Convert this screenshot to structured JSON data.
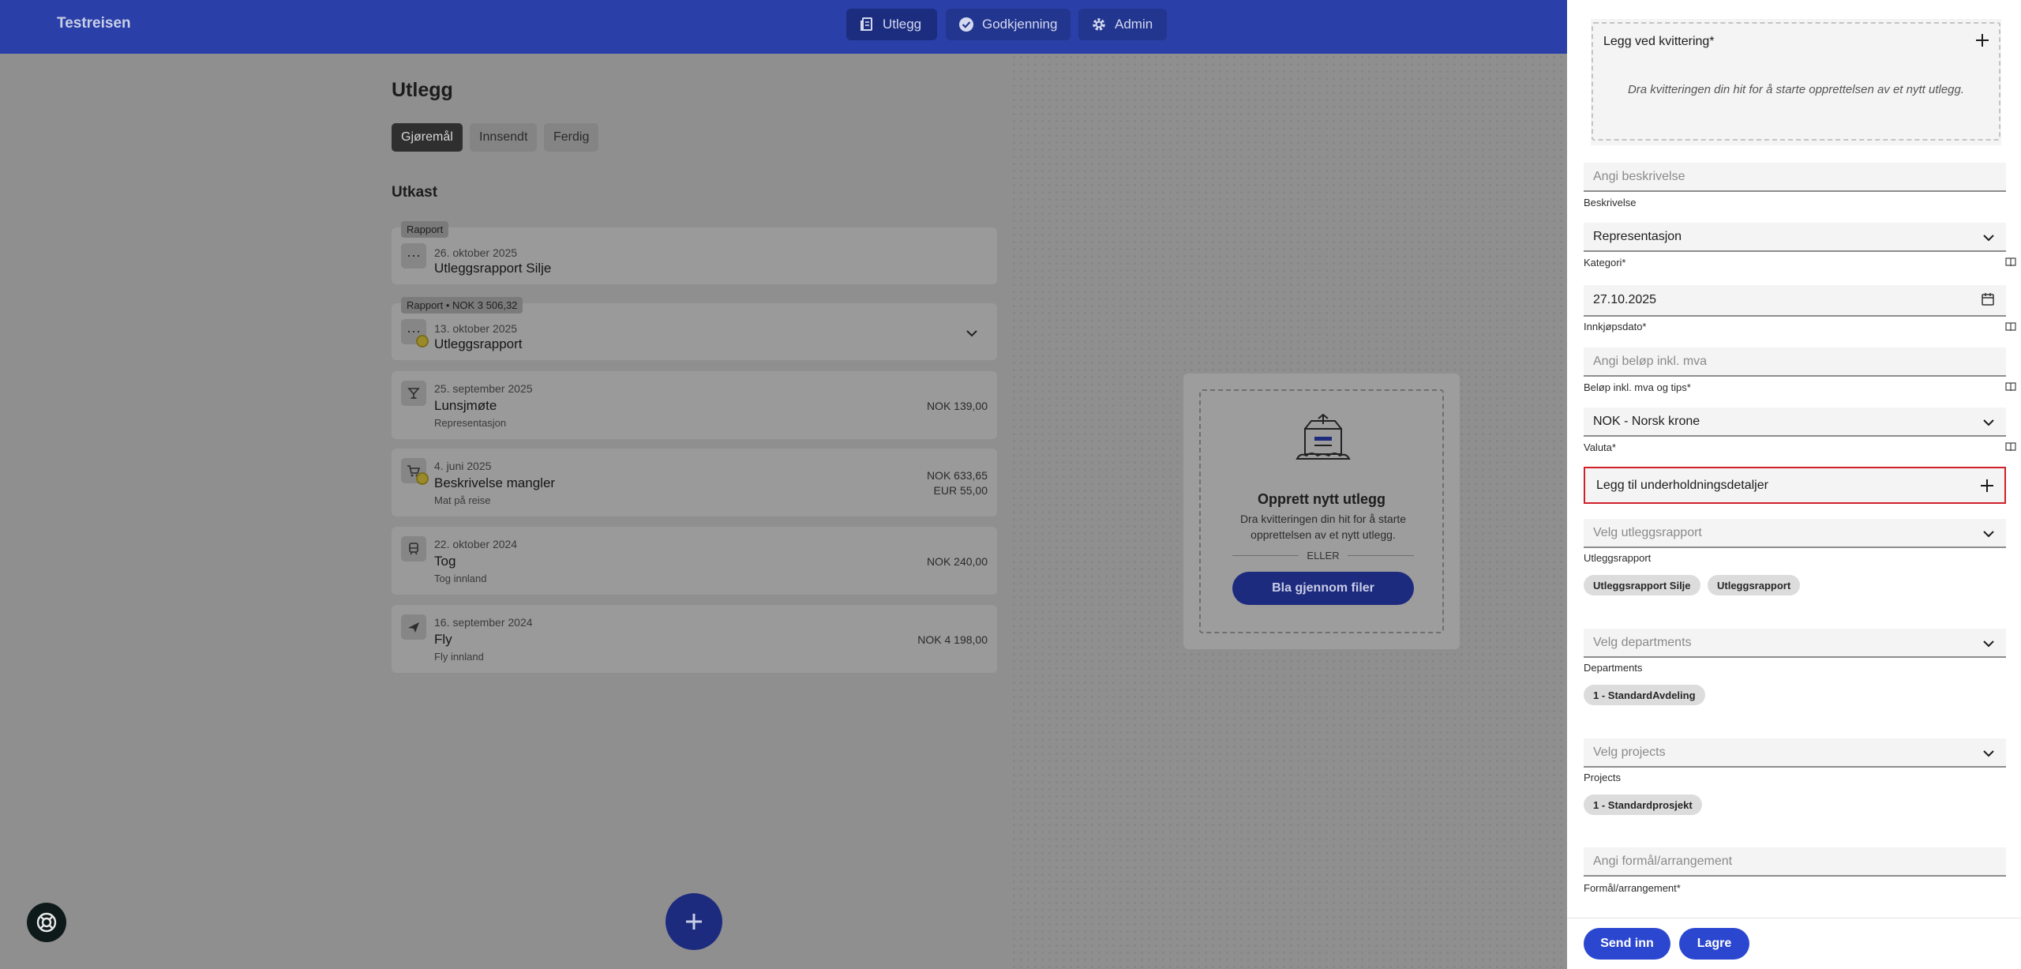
{
  "header": {
    "brand": "Testreisen",
    "nav": [
      {
        "label": "Utlegg",
        "icon": "receipt-icon"
      },
      {
        "label": "Godkjenning",
        "icon": "check-circle-icon"
      },
      {
        "label": "Admin",
        "icon": "gear-icon"
      }
    ]
  },
  "main": {
    "title": "Utlegg",
    "tabs": [
      "Gjøremål",
      "Innsendt",
      "Ferdig"
    ],
    "section_title": "Utkast",
    "cards": [
      {
        "badge": "Rapport",
        "date": "26. oktober 2025",
        "title": "Utleggsrapport Silje",
        "icon": "more-icon"
      },
      {
        "badge": "Rapport • NOK 3 506,32",
        "date": "13. oktober 2025",
        "title": "Utleggsrapport",
        "icon": "more-icon"
      },
      {
        "date": "25. september 2025",
        "title": "Lunsjmøte",
        "sub": "Representasjon",
        "amount": "NOK 139,00",
        "icon": "cocktail-icon"
      },
      {
        "date": "4. juni 2025",
        "title": "Beskrivelse mangler",
        "sub": "Mat på reise",
        "amount": "NOK 633,65",
        "amount2": "EUR 55,00",
        "icon": "cart-icon"
      },
      {
        "date": "22. oktober 2024",
        "title": "Tog",
        "sub": "Tog innland",
        "amount": "NOK 240,00",
        "icon": "train-icon"
      },
      {
        "date": "16. september 2024",
        "title": "Fly",
        "sub": "Fly innland",
        "amount": "NOK 4 198,00",
        "icon": "plane-icon"
      }
    ],
    "upload": {
      "title": "Opprett nytt utlegg",
      "text": "Dra kvitteringen din hit for å starte opprettelsen av et nytt utlegg.",
      "or": "ELLER",
      "button": "Bla gjennom filer"
    }
  },
  "drawer": {
    "receipt_title": "Legg ved kvittering*",
    "receipt_hint": "Dra kvitteringen din hit for å starte opprettelsen av et nytt utlegg.",
    "description": {
      "placeholder": "Angi beskrivelse",
      "label": "Beskrivelse"
    },
    "category": {
      "value": "Representasjon",
      "label": "Kategori*"
    },
    "date": {
      "value": "27.10.2025",
      "label": "Innkjøpsdato*"
    },
    "amount": {
      "placeholder": "Angi beløp inkl. mva",
      "label": "Beløp inkl. mva og tips*"
    },
    "currency": {
      "value": "NOK - Norsk krone",
      "label": "Valuta*"
    },
    "entertainment": "Legg til underholdningsdetaljer",
    "report": {
      "placeholder": "Velg utleggsrapport",
      "label": "Utleggsrapport",
      "chips": [
        "Utleggsrapport Silje",
        "Utleggsrapport"
      ]
    },
    "departments": {
      "placeholder": "Velg departments",
      "label": "Departments",
      "chips": [
        "1 - StandardAvdeling"
      ]
    },
    "projects": {
      "placeholder": "Velg projects",
      "label": "Projects",
      "chips": [
        "1 - Standardprosjekt"
      ]
    },
    "purpose": {
      "placeholder": "Angi formål/arrangement",
      "label": "Formål/arrangement*"
    },
    "submit": "Send inn",
    "save": "Lagre"
  }
}
